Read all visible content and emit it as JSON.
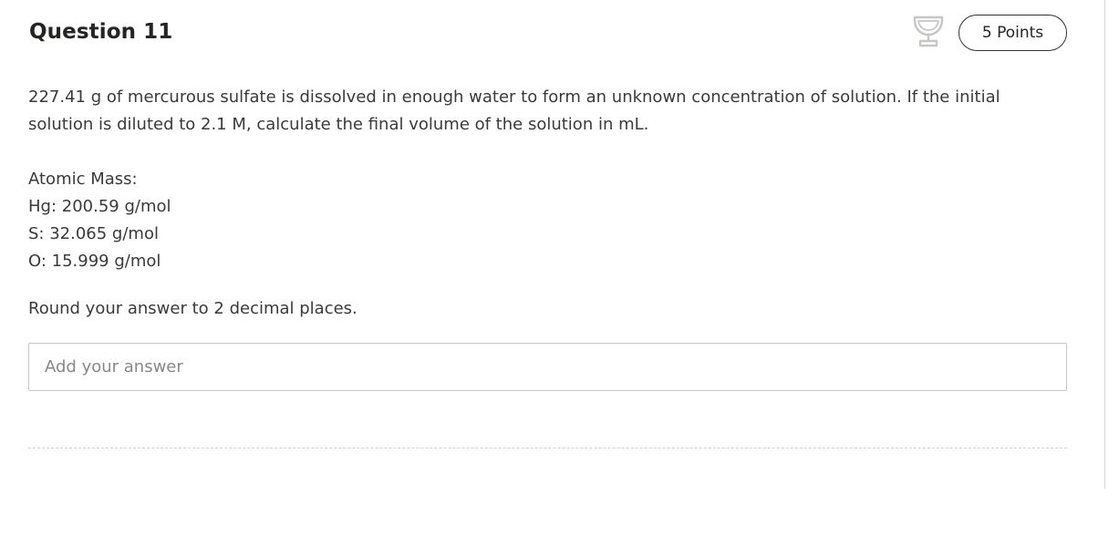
{
  "question": {
    "title": "Question 11",
    "points": "5 Points",
    "trophy_icon": "trophy-icon",
    "body": [
      "227.41 g of mercurous sulfate is dissolved in enough water to form an unknown concentration of solution. If the initial solution is diluted to 2.1 M, calculate the final volume of the solution in mL."
    ],
    "atomic_mass": {
      "heading": "Atomic Mass:",
      "lines": [
        "Hg: 200.59 g/mol",
        "S: 32.065 g/mol",
        "O: 15.999 g/mol"
      ]
    },
    "rounding_note": "Round your answer to 2 decimal places.",
    "answer": {
      "placeholder": "Add your answer",
      "value": ""
    }
  },
  "colors": {
    "border": "#c8c6c4",
    "text": "#3b3a39",
    "trophy": "#c8c6c4"
  }
}
